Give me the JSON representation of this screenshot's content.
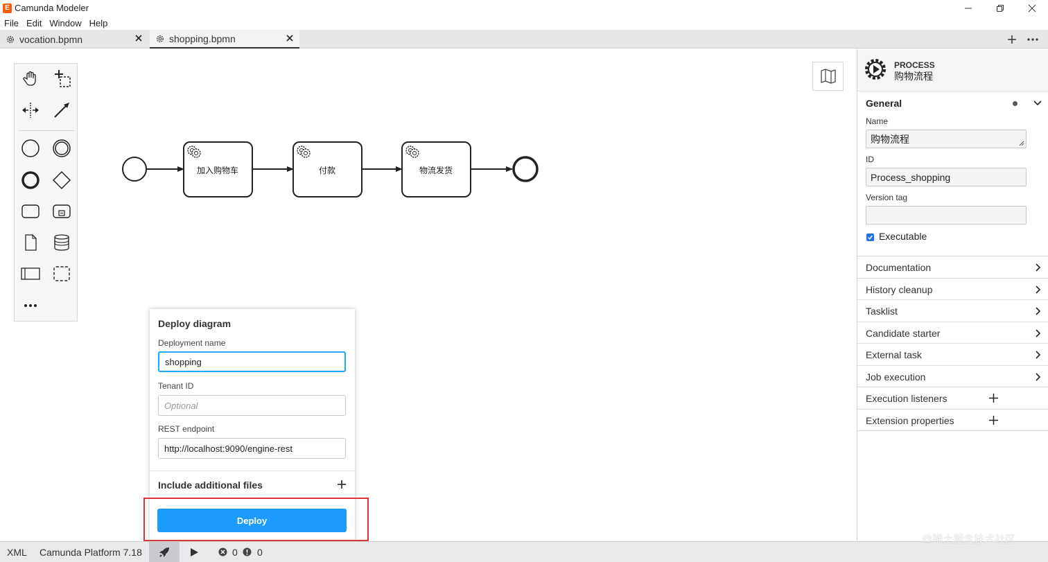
{
  "app": {
    "logo_letter": "E",
    "title": "Camunda Modeler"
  },
  "menu": [
    "File",
    "Edit",
    "Window",
    "Help"
  ],
  "tabs": [
    {
      "label": "vocation.bpmn"
    },
    {
      "label": "shopping.bpmn"
    }
  ],
  "diagram": {
    "tasks": [
      "加入购物车",
      "付款",
      "物流发货"
    ]
  },
  "deploy": {
    "title": "Deploy diagram",
    "deployment_name_label": "Deployment name",
    "deployment_name_value": "shopping",
    "tenant_label": "Tenant ID",
    "tenant_placeholder": "Optional",
    "endpoint_label": "REST endpoint",
    "endpoint_value": "http://localhost:9090/engine-rest",
    "include_label": "Include additional files",
    "deploy_button": "Deploy"
  },
  "properties": {
    "element_type": "PROCESS",
    "element_name": "购物流程",
    "group_general": "General",
    "name_label": "Name",
    "name_value": "购物流程",
    "id_label": "ID",
    "id_value": "Process_shopping",
    "version_tag_label": "Version tag",
    "version_tag_value": "",
    "executable_label": "Executable",
    "sections": [
      {
        "label": "Documentation"
      },
      {
        "label": "History cleanup"
      },
      {
        "label": "Tasklist"
      },
      {
        "label": "Candidate starter"
      },
      {
        "label": "External task"
      },
      {
        "label": "Job execution"
      },
      {
        "label": "Execution listeners"
      },
      {
        "label": "Extension properties"
      }
    ]
  },
  "status": {
    "xml": "XML",
    "platform": "Camunda Platform 7.18",
    "errors": "0",
    "warnings": "0"
  },
  "watermark": "@稀土掘金技术社区",
  "colors": {
    "accent": "#1a9bfd",
    "highlight": "#d9343a",
    "brand": "#fc5d0d"
  }
}
